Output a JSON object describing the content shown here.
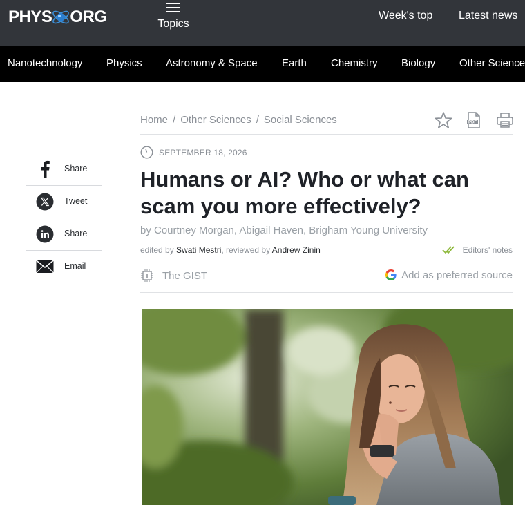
{
  "header": {
    "logo_left": "PHYS",
    "logo_right": "ORG",
    "topics_label": "Topics",
    "links": [
      "Week's top",
      "Latest news"
    ]
  },
  "categories": [
    "Nanotechnology",
    "Physics",
    "Astronomy & Space",
    "Earth",
    "Chemistry",
    "Biology",
    "Other Sciences"
  ],
  "breadcrumb": [
    "Home",
    "Other Sciences",
    "Social Sciences"
  ],
  "breadcrumb_sep": "/",
  "tools": [
    "star-icon",
    "pdf-icon",
    "print-icon"
  ],
  "pdf_badge": "PDF",
  "share": [
    {
      "icon": "facebook-icon",
      "label": "Share"
    },
    {
      "icon": "x-icon",
      "label": "Tweet"
    },
    {
      "icon": "linkedin-icon",
      "label": "Share"
    },
    {
      "icon": "email-icon",
      "label": "Email"
    }
  ],
  "article": {
    "date": "SEPTEMBER 18, 2026",
    "title": "Humans or AI? Who or what can scam you more effectively?",
    "byline": "by Courtney Morgan, Abigail Haven, Brigham Young University",
    "edited_prefix": "edited by",
    "editor": "Swati Mestri",
    "reviewed_prefix": ", reviewed by",
    "reviewer": "Andrew Zinin",
    "editors_notes": "Editors' notes",
    "gist": "The GIST",
    "preferred_source": "Add as preferred source"
  },
  "colors": {
    "topbar": "#32353a",
    "navbar": "#000000",
    "muted_text": "#8a8f96",
    "check_green": "#8db83a"
  }
}
